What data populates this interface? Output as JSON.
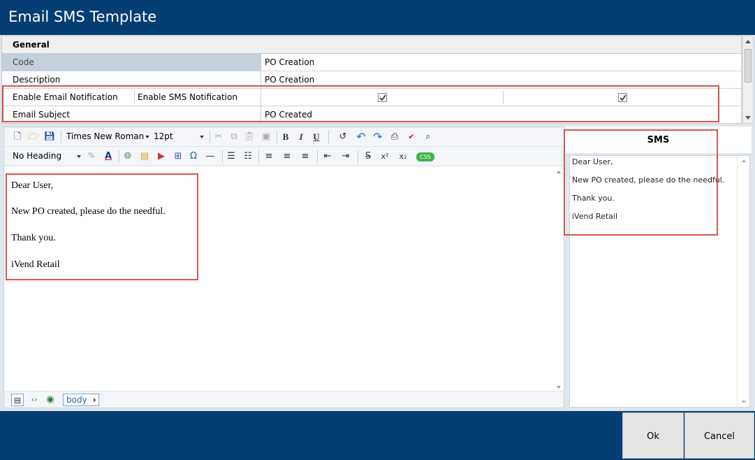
{
  "window": {
    "title": "Email SMS Template"
  },
  "general": {
    "section_title": "General",
    "rows": [
      {
        "label": "Code",
        "value": "PO Creation"
      },
      {
        "label": "Description",
        "value": "PO Creation"
      },
      {
        "label": "Email Subject",
        "value": "PO Created"
      }
    ],
    "notify": {
      "email_label": "Enable Email Notification",
      "sms_label": "Enable SMS Notification",
      "email_checked": true,
      "sms_checked": true
    }
  },
  "editor": {
    "font_family": "Times New Roman",
    "font_size": "12pt",
    "heading": "No Heading",
    "body_lines": [
      "Dear User,",
      "New PO created, please do the needful.",
      "Thank you.",
      "iVend Retail"
    ],
    "path_tag": "body",
    "icons": [
      "new-document-icon",
      "open-folder-icon",
      "save-icon",
      "cut-icon",
      "copy-icon",
      "paste-icon",
      "paste-word-icon",
      "bold-icon",
      "italic-icon",
      "underline-icon",
      "redo-icon",
      "undo-icon",
      "forward-icon",
      "print-icon",
      "spellcheck-icon",
      "find-icon",
      "highlight-icon",
      "font-color-icon",
      "hyperlink-icon",
      "image-icon",
      "media-icon",
      "table-icon",
      "omega-icon",
      "horizontal-rule-icon",
      "ordered-list-icon",
      "unordered-list-icon",
      "align-left-icon",
      "align-center-icon",
      "align-right-icon",
      "outdent-icon",
      "indent-icon",
      "strikethrough-icon",
      "superscript-icon",
      "subscript-icon",
      "css-icon",
      "design-mode-icon",
      "html-mode-icon",
      "preview-mode-icon"
    ]
  },
  "sms": {
    "title": "SMS",
    "lines": [
      "Dear User,",
      "New PO created, please do the needful.",
      "Thank you.",
      "iVend Retail"
    ]
  },
  "buttons": {
    "ok": "Ok",
    "cancel": "Cancel"
  },
  "colors": {
    "brand": "#043e73",
    "highlight_border": "#d9534f",
    "selected_row": "#c3cfdb"
  }
}
